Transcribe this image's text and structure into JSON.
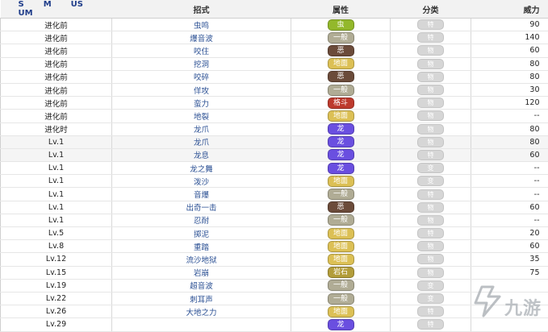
{
  "header": {
    "versions": [
      "S",
      "M",
      "US",
      "UM"
    ],
    "move": "招式",
    "type": "属性",
    "category": "分类",
    "power": "威力"
  },
  "type_colors": {
    "虫": "#93b82b",
    "一般": "#b0ac95",
    "恶": "#6b4b3a",
    "地面": "#dcc055",
    "格斗": "#bd3a2d",
    "龙": "#6a4fe0",
    "岩石": "#b39d3a"
  },
  "rows": [
    {
      "learn": "进化前",
      "move": "虫鸣",
      "type": "虫",
      "category": "特",
      "power": "90"
    },
    {
      "learn": "进化前",
      "move": "爆音波",
      "type": "一般",
      "category": "特",
      "power": "140"
    },
    {
      "learn": "进化前",
      "move": "咬住",
      "type": "恶",
      "category": "物",
      "power": "60"
    },
    {
      "learn": "进化前",
      "move": "挖洞",
      "type": "地面",
      "category": "物",
      "power": "80"
    },
    {
      "learn": "进化前",
      "move": "咬碎",
      "type": "恶",
      "category": "物",
      "power": "80"
    },
    {
      "learn": "进化前",
      "move": "佯攻",
      "type": "一般",
      "category": "物",
      "power": "30"
    },
    {
      "learn": "进化前",
      "move": "蛮力",
      "type": "格斗",
      "category": "物",
      "power": "120"
    },
    {
      "learn": "进化前",
      "move": "地裂",
      "type": "地面",
      "category": "物",
      "power": "--"
    },
    {
      "learn": "进化时",
      "move": "龙爪",
      "type": "龙",
      "category": "物",
      "power": "80"
    },
    {
      "learn": "Lv.1",
      "move": "龙爪",
      "type": "龙",
      "category": "物",
      "power": "80"
    },
    {
      "learn": "Lv.1",
      "move": "龙息",
      "type": "龙",
      "category": "特",
      "power": "60"
    },
    {
      "learn": "Lv.1",
      "move": "龙之舞",
      "type": "龙",
      "category": "变",
      "power": "--"
    },
    {
      "learn": "Lv.1",
      "move": "泼沙",
      "type": "地面",
      "category": "变",
      "power": "--"
    },
    {
      "learn": "Lv.1",
      "move": "音爆",
      "type": "一般",
      "category": "特",
      "power": "--"
    },
    {
      "learn": "Lv.1",
      "move": "出奇一击",
      "type": "恶",
      "category": "物",
      "power": "60"
    },
    {
      "learn": "Lv.1",
      "move": "忍耐",
      "type": "一般",
      "category": "物",
      "power": "--"
    },
    {
      "learn": "Lv.5",
      "move": "掷泥",
      "type": "地面",
      "category": "特",
      "power": "20"
    },
    {
      "learn": "Lv.8",
      "move": "重踏",
      "type": "地面",
      "category": "物",
      "power": "60"
    },
    {
      "learn": "Lv.12",
      "move": "流沙地狱",
      "type": "地面",
      "category": "物",
      "power": "35"
    },
    {
      "learn": "Lv.15",
      "move": "岩崩",
      "type": "岩石",
      "category": "物",
      "power": "75"
    },
    {
      "learn": "Lv.19",
      "move": "超音波",
      "type": "一般",
      "category": "变",
      "power": ""
    },
    {
      "learn": "Lv.22",
      "move": "刺耳声",
      "type": "一般",
      "category": "变",
      "power": ""
    },
    {
      "learn": "Lv.26",
      "move": "大地之力",
      "type": "地面",
      "category": "特",
      "power": ""
    },
    {
      "learn": "Lv.29",
      "move": "",
      "type": "龙",
      "category": "特",
      "power": ""
    }
  ],
  "watermark": "九游"
}
